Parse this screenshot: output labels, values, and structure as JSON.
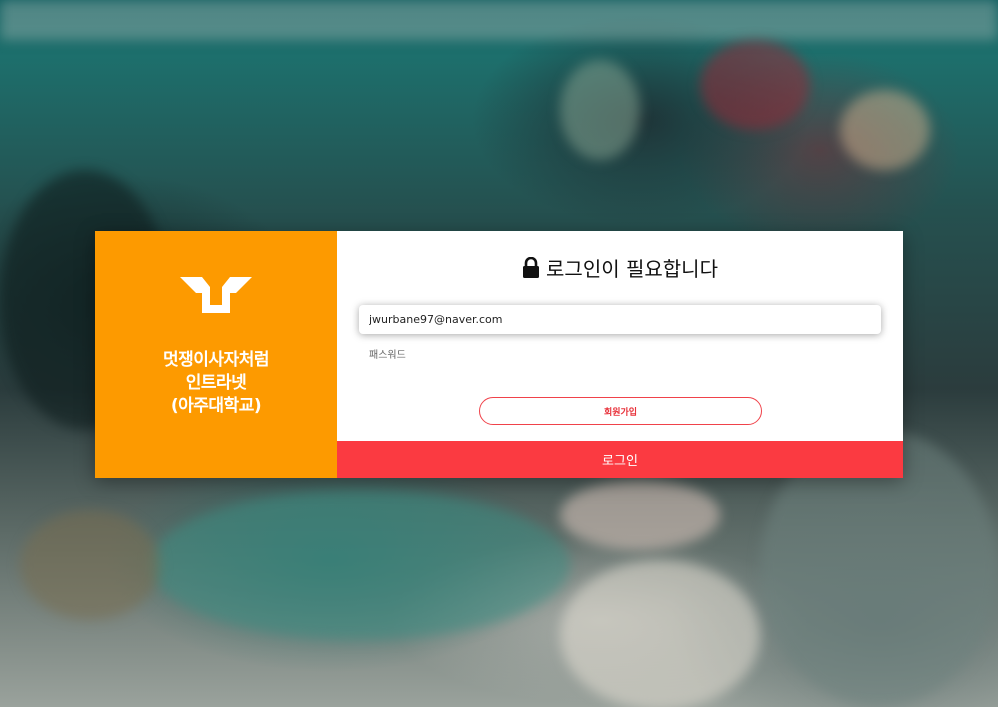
{
  "brand": {
    "logo_icon": "lion-face-logo-icon",
    "name_line1": "멋쟁이사자처럼",
    "name_line2": "인트라넷",
    "name_line3": "(아주대학교)",
    "color": "#fd9a00"
  },
  "login": {
    "lock_icon": "lock-icon",
    "title": "로그인이 필요합니다",
    "email_value": "jwurbane97@naver.com",
    "password_placeholder": "패스워드",
    "signup_label": "회원가입",
    "login_label": "로그인",
    "accent_color": "#fb3a41"
  }
}
